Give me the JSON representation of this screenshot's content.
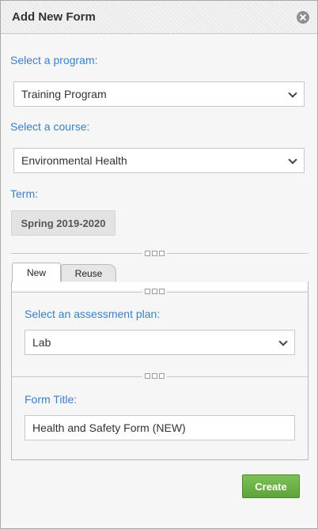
{
  "dialog": {
    "title": "Add New Form"
  },
  "program": {
    "label": "Select a program:",
    "selected": "Training Program"
  },
  "course": {
    "label": "Select a course:",
    "selected": "Environmental Health"
  },
  "term": {
    "label": "Term:",
    "value": "Spring 2019-2020"
  },
  "tabs": [
    {
      "label": "New",
      "active": true
    },
    {
      "label": "Reuse",
      "active": false
    }
  ],
  "assessment_plan": {
    "label": "Select an assessment plan:",
    "selected": "Lab"
  },
  "form_title": {
    "label": "Form Title:",
    "value": "Health and Safety Form (NEW)"
  },
  "actions": {
    "create_label": "Create"
  },
  "colors": {
    "label_blue": "#3a7fc9",
    "create_green": "#6cb247",
    "title_bar": "#ececec"
  },
  "icons": [
    "close-icon",
    "chevron-down-icon",
    "grip-handle-icon"
  ]
}
